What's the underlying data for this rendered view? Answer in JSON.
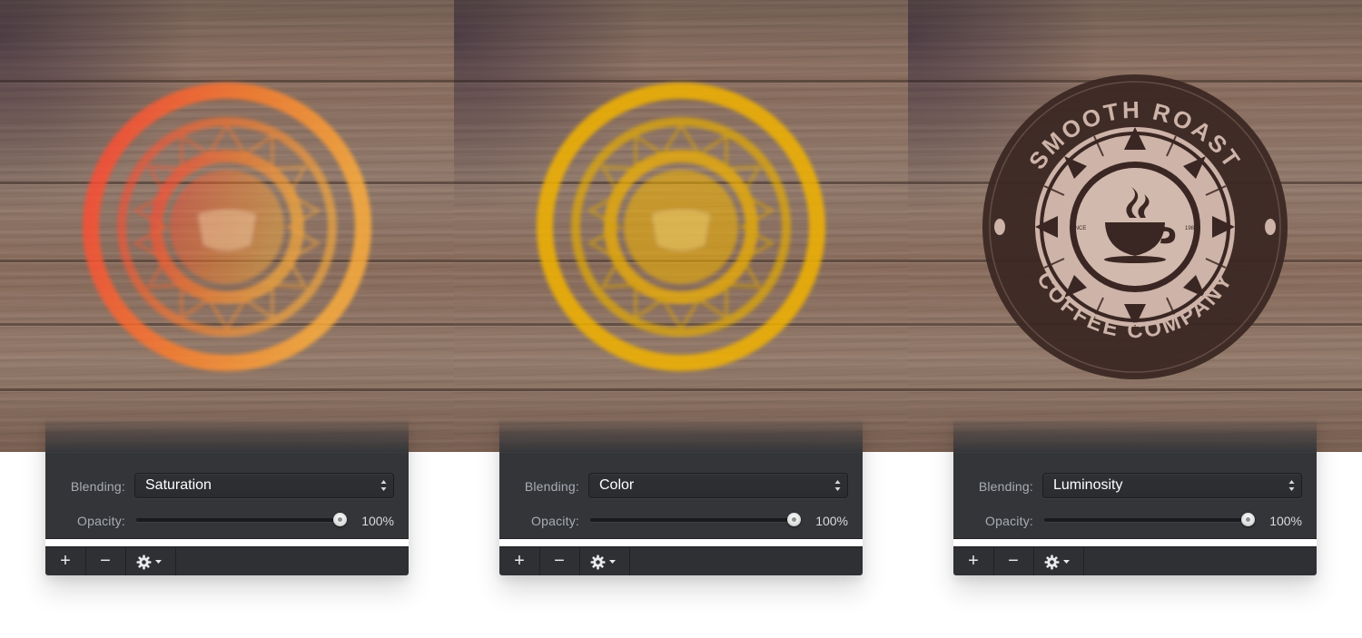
{
  "panels": [
    {
      "blending_label": "Blending:",
      "blending_value": "Saturation",
      "opacity_label": "Opacity:",
      "opacity_value": "100%",
      "opacity_level": 1.0,
      "logo_style": "saturation",
      "icons": {
        "select": "updown-chevron-icon",
        "add": "plus-icon",
        "remove": "minus-icon",
        "settings": "gear-icon",
        "menu": "caret-down-icon"
      },
      "add_label": "+",
      "remove_label": "−"
    },
    {
      "blending_label": "Blending:",
      "blending_value": "Color",
      "opacity_label": "Opacity:",
      "opacity_value": "100%",
      "opacity_level": 1.0,
      "logo_style": "color",
      "icons": {
        "select": "updown-chevron-icon",
        "add": "plus-icon",
        "remove": "minus-icon",
        "settings": "gear-icon",
        "menu": "caret-down-icon"
      },
      "add_label": "+",
      "remove_label": "−"
    },
    {
      "blending_label": "Blending:",
      "blending_value": "Luminosity",
      "opacity_label": "Opacity:",
      "opacity_value": "100%",
      "opacity_level": 1.0,
      "logo_style": "luminosity",
      "icons": {
        "select": "updown-chevron-icon",
        "add": "plus-icon",
        "remove": "minus-icon",
        "settings": "gear-icon",
        "menu": "caret-down-icon"
      },
      "add_label": "+",
      "remove_label": "−"
    }
  ],
  "logo": {
    "top_text": "SMOOTH ROAST",
    "bottom_text": "COFFEE COMPANY",
    "since_label": "SINCE",
    "year_label": "1981"
  },
  "colors": {
    "panel_background": "#333539",
    "saturation_tint": "#ff7a2a",
    "saturation_edge": "#ff4a2e",
    "color_tint": "#f2b300",
    "luminosity_tint": "#3a2622",
    "luminosity_light": "#d9c0b5"
  }
}
